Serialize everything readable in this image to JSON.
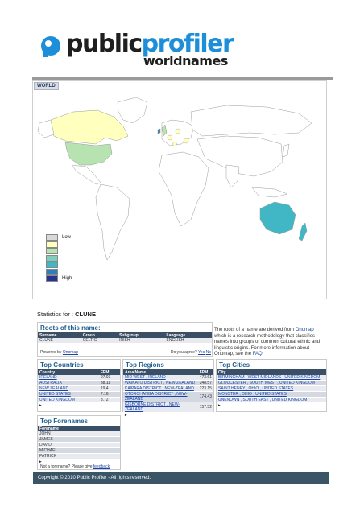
{
  "brand": {
    "title_part1": "public",
    "title_part2": "profiler",
    "subtitle": "worldnames"
  },
  "map": {
    "tab_label": "WORLD",
    "legend": [
      {
        "label": "Low",
        "color": "#d9d9d9"
      },
      {
        "label": "",
        "color": "#ffffbe"
      },
      {
        "label": "",
        "color": "#b7e3b0"
      },
      {
        "label": "",
        "color": "#7fcdbb"
      },
      {
        "label": "",
        "color": "#41b6c4"
      },
      {
        "label": "",
        "color": "#2c7fb8"
      },
      {
        "label": "High",
        "color": "#253494"
      }
    ]
  },
  "stats": {
    "label": "Statistics for : ",
    "name": "CLUNE"
  },
  "roots": {
    "title": "Roots of this name:",
    "headers": [
      "Surname",
      "Group",
      "Subgroup",
      "Language"
    ],
    "row": [
      "CLUNE",
      "CELTIC",
      "IRISH",
      "ENGLISH"
    ],
    "powered_by": "Powered by",
    "onomap_link": "Onomap",
    "agree_q": "Do you agree?",
    "yes": "Yes",
    "no": "No"
  },
  "explain": {
    "text1": "The roots of a name are derived from ",
    "link1": "Onomap",
    "text2": " which is a research methodology that classifies names into groups of common cultural ethnic and linguistic origins. For more information about Onomap, see the ",
    "link2": "FAQ",
    "text3": "."
  },
  "countries": {
    "title": "Top Countries",
    "headers": [
      "Country",
      "FPM"
    ],
    "rows": [
      {
        "name": "IRELAND",
        "fpm": "97.03"
      },
      {
        "name": "AUSTRALIA",
        "fpm": "38.11"
      },
      {
        "name": "NEW ZEALAND",
        "fpm": "19.4"
      },
      {
        "name": "UNITED STATES",
        "fpm": "7.16"
      },
      {
        "name": "UNITED KINGDOM",
        "fpm": "3.72"
      }
    ]
  },
  "regions": {
    "title": "Top Regions",
    "headers": [
      "Area Name",
      "FPM"
    ],
    "rows": [
      {
        "name": "MID WEST , IRELAND",
        "fpm": "473.61"
      },
      {
        "name": "WAIKATO DISTRICT , NEW-ZEALAND",
        "fpm": "248.57"
      },
      {
        "name": "KAIPARA DISTRICT , NEW-ZEALAND",
        "fpm": "223.15"
      },
      {
        "name": "OTOROHANGA DISTRICT , NEW-ZEALAND",
        "fpm": "174.43"
      },
      {
        "name": "GISBORNE DISTRICT , NEW-ZEALAND",
        "fpm": "157.52"
      }
    ]
  },
  "cities": {
    "title": "Top Cities",
    "headers": [
      "City"
    ],
    "rows": [
      "BIRMINGHAM , WEST MIDLANDS , UNITED KINGDOM",
      "GLOUCESTER , SOUTH WEST , UNITED KINGDOM",
      "SAINT HENRY , OHIO , UNITED STATES",
      "MONSTER , OHIO , UNITED STATES",
      "UNKNOWN , SOUTH EAST , UNITED KINGDOM"
    ]
  },
  "forenames": {
    "title": "Top Forenames",
    "headers": [
      "Forename"
    ],
    "rows": [
      "JOHN",
      "JAMES",
      "DAVID",
      "MICHAEL",
      "PATRICK"
    ],
    "feedback_text": "Not a forename? Please give ",
    "feedback_link": "feedback"
  },
  "footer": {
    "text": "Copyright © 2010 Public Profiler - All rights reserved."
  }
}
